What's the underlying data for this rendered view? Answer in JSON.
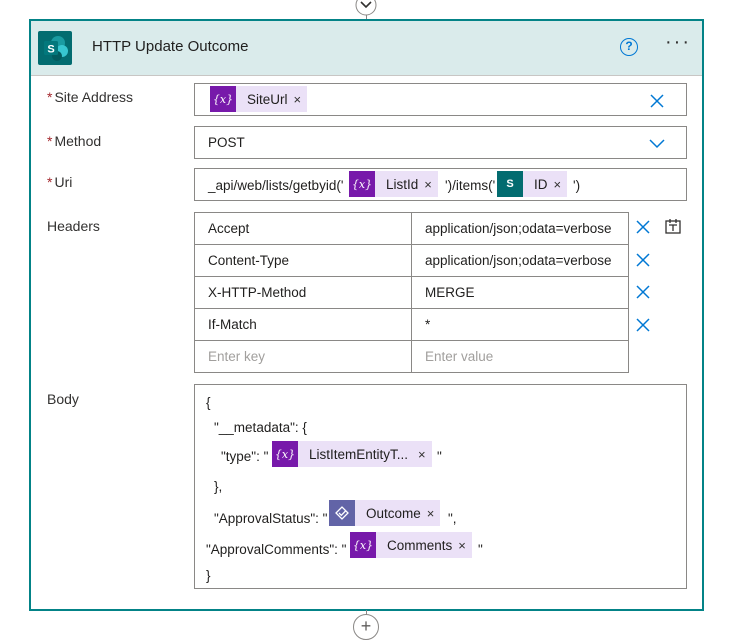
{
  "card": {
    "title": "HTTP Update Outcome",
    "help_glyph": "?",
    "more_glyph": "···",
    "accent_color": "#038387",
    "header_color": "#daebeb"
  },
  "fields": {
    "site_address": {
      "label": "Site Address",
      "required_mark": "*",
      "token": {
        "icon": "{x}",
        "label": "SiteUrl",
        "remove": "×"
      }
    },
    "method": {
      "label": "Method",
      "required_mark": "*",
      "value": "POST"
    },
    "uri": {
      "label": "Uri",
      "required_mark": "*",
      "prefix": "_api/web/lists/getbyid('",
      "token1": {
        "icon": "{x}",
        "label": "ListId",
        "remove": "×"
      },
      "middle": "')/items('",
      "token2": {
        "icon": "S",
        "label": "ID",
        "remove": "×"
      },
      "suffix": "')"
    },
    "headers": {
      "label": "Headers",
      "rows": [
        {
          "key": "Accept",
          "value": "application/json;odata=verbose"
        },
        {
          "key": "Content-Type",
          "value": "application/json;odata=verbose"
        },
        {
          "key": "X-HTTP-Method",
          "value": "MERGE"
        },
        {
          "key": "If-Match",
          "value": "*"
        }
      ],
      "key_placeholder": "Enter key",
      "value_placeholder": "Enter value"
    },
    "body": {
      "label": "Body",
      "line1": "{",
      "line2": "\"__metadata\": {",
      "line3_prefix": "\"type\": \"",
      "line3_token": {
        "icon": "{x}",
        "label": "ListItemEntityT...",
        "remove": "×"
      },
      "line3_suffix": "\"",
      "line4": "},",
      "line5_prefix": "\"ApprovalStatus\": \"",
      "line5_token": {
        "icon": "approval",
        "label": "Outcome",
        "remove": "×"
      },
      "line5_suffix": "\",",
      "line6_prefix": "\"ApprovalComments\": \"",
      "line6_token": {
        "icon": "{x}",
        "label": "Comments",
        "remove": "×"
      },
      "line6_suffix": "\"",
      "line7": "}"
    }
  },
  "connector": {
    "add_glyph": "+"
  },
  "colors": {
    "variable_token": "#7719aa",
    "token_bg": "#ebe1f7",
    "sharepoint": "#036c70",
    "approval": "#6264a7",
    "link_blue": "#0078d4",
    "required": "#a4262c"
  }
}
